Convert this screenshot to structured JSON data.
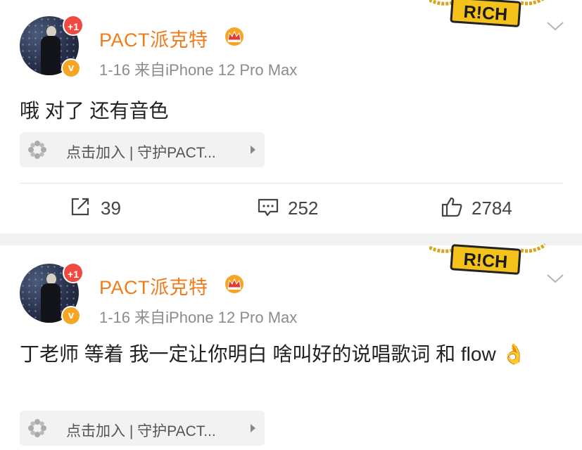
{
  "posts": [
    {
      "username": "PACT派克特",
      "meta": "1-16  来自iPhone 12 Pro Max",
      "plus_badge": "+1",
      "verified_badge": "v",
      "content": "哦 对了 还有音色",
      "pill_label": "点击加入 | 守护PACT...",
      "reposts": "39",
      "comments": "252",
      "likes": "2784",
      "rich_tag": "R!CH"
    },
    {
      "username": "PACT派克特",
      "meta": "1-16  来自iPhone 12 Pro Max",
      "plus_badge": "+1",
      "verified_badge": "v",
      "content": "丁老师 等着 我一定让你明白 啥叫好的说唱歌词 和 flow 👌",
      "pill_label": "点击加入 | 守护PACT...",
      "rich_tag": "R!CH"
    }
  ],
  "colors": {
    "username": "#f07b1a",
    "badge_red": "#f04a43",
    "badge_gold": "#f6a623",
    "meta": "#8c8c8c",
    "gold": "#e8b923"
  },
  "icons": {
    "crown": "crown-icon",
    "rich": "rich-chain-icon",
    "chevron": "chevron-down-icon",
    "flower": "flower-icon",
    "repost": "repost-icon",
    "comment": "comment-icon",
    "like": "like-icon"
  }
}
